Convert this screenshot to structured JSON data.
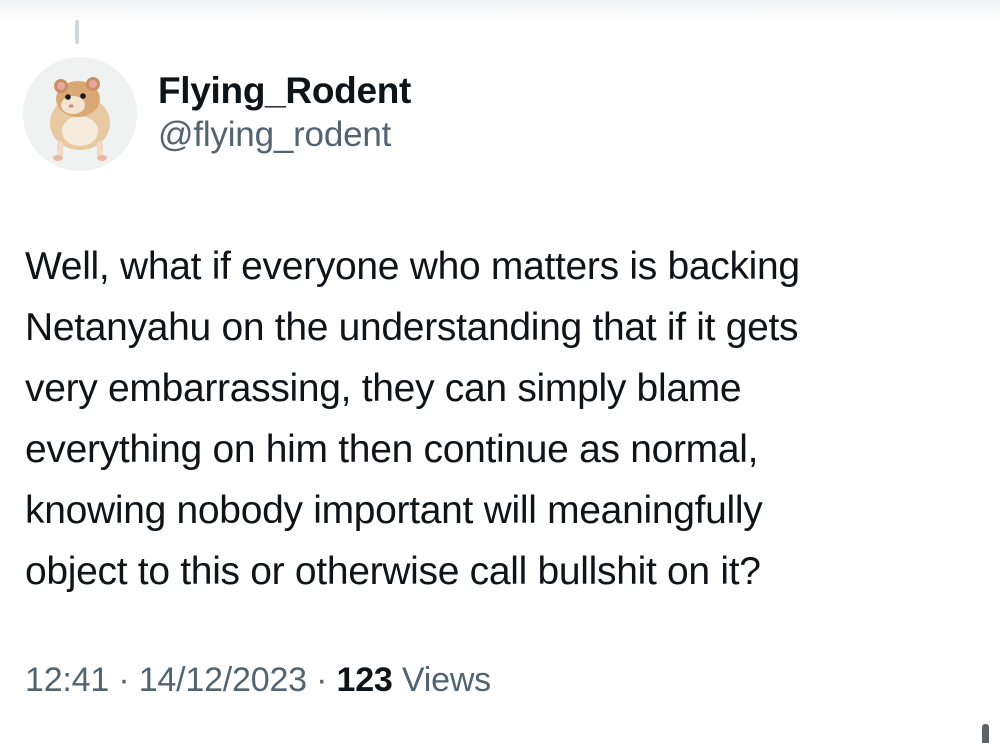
{
  "author": {
    "display_name": "Flying_Rodent",
    "handle": "@flying_rodent",
    "avatar_icon": "hamster-avatar-icon"
  },
  "tweet": {
    "lines": [
      "Well, what if everyone who matters is backing",
      "Netanyahu on the understanding that if it gets",
      "very embarrassing, they can simply blame",
      "everything on him then continue as normal,",
      "knowing nobody important will meaningfully",
      "object to this or otherwise call bullshit on it?"
    ]
  },
  "meta": {
    "time": "12:41",
    "separator": "·",
    "date": "14/12/2023",
    "views_count": "123",
    "views_label": "Views"
  },
  "colors": {
    "text_primary": "#0f1419",
    "text_secondary": "#536471",
    "thread_line": "#cfd9de"
  }
}
